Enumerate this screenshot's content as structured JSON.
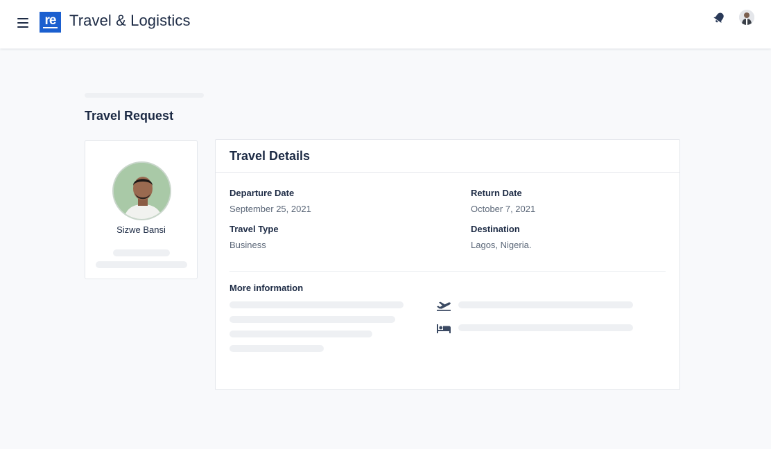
{
  "header": {
    "app_title": "Travel & Logistics",
    "logo_text": "re",
    "icons": [
      "menu-icon",
      "bell-icon",
      "user-avatar"
    ]
  },
  "page": {
    "title": "Travel Request"
  },
  "profile": {
    "name": "Sizwe Bansi"
  },
  "travel_details": {
    "title": "Travel Details",
    "departure_label": "Departure Date",
    "departure_value": "September 25, 2021",
    "return_label": "Return Date",
    "return_value": "October 7, 2021",
    "type_label": "Travel Type",
    "type_value": "Business",
    "destination_label": "Destination",
    "destination_value": "Lagos, Nigeria.",
    "more_info_label": "More information",
    "more_info_icons": [
      "flight-departure-icon",
      "hotel-bed-icon"
    ]
  },
  "colors": {
    "brand": "#1b5fcf",
    "text_primary": "#1c2a44",
    "text_secondary": "#5b6778",
    "skeleton": "#eef0f3",
    "background": "#f8f9fb"
  }
}
